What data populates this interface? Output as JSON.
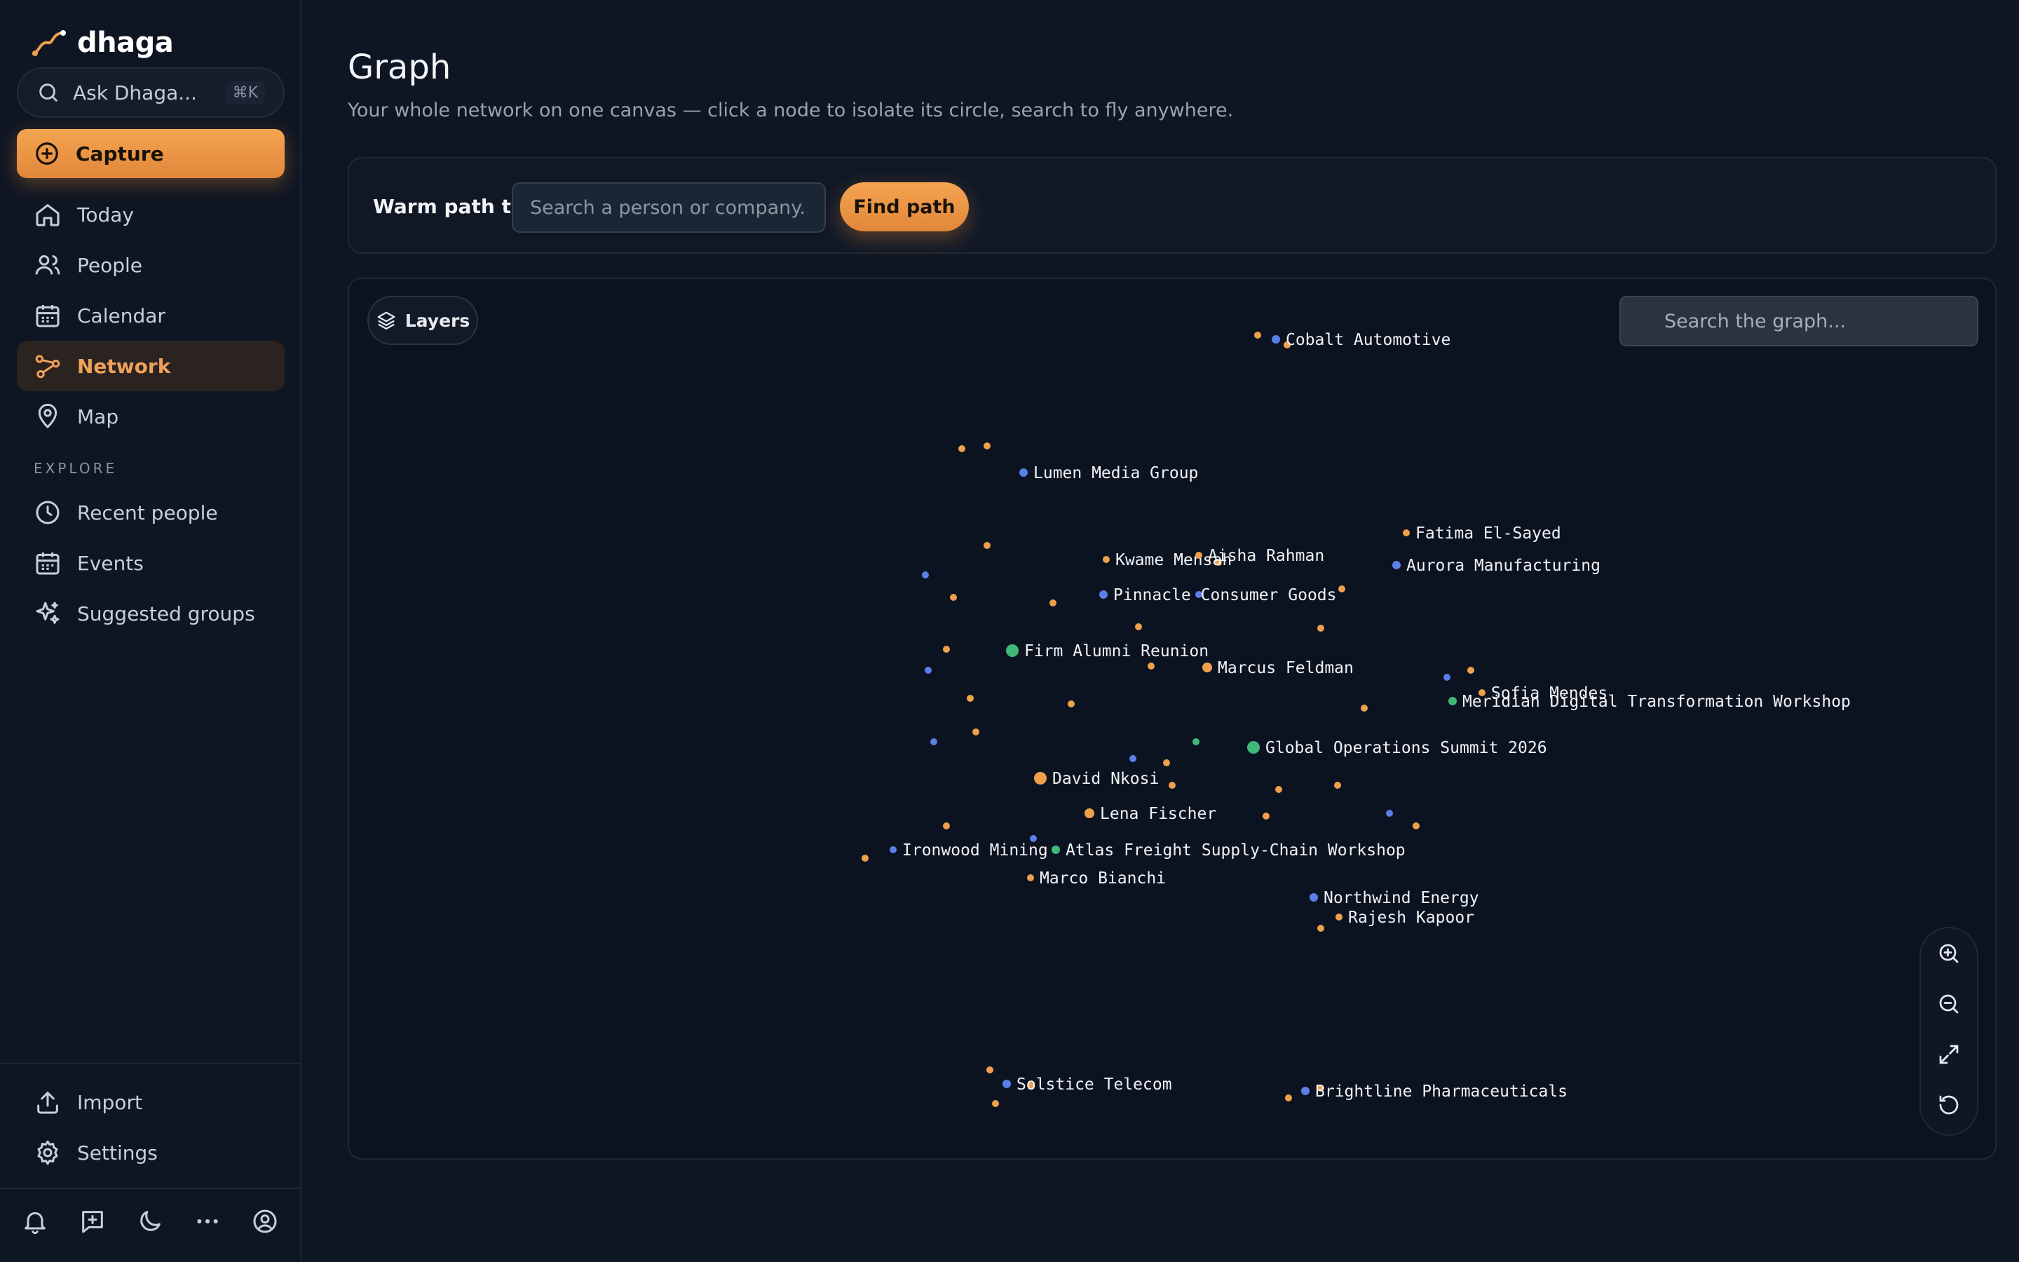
{
  "app": {
    "name": "dhaga"
  },
  "sidebar": {
    "ask": {
      "label": "Ask Dhaga...",
      "shortcut": "⌘K"
    },
    "capture_label": "Capture",
    "nav": [
      {
        "label": "Today",
        "icon": "home-icon"
      },
      {
        "label": "People",
        "icon": "people-icon"
      },
      {
        "label": "Calendar",
        "icon": "calendar-icon"
      },
      {
        "label": "Network",
        "icon": "network-icon",
        "active": true
      },
      {
        "label": "Map",
        "icon": "map-pin-icon"
      }
    ],
    "explore_label": "EXPLORE",
    "explore": [
      {
        "label": "Recent people",
        "icon": "clock-icon"
      },
      {
        "label": "Events",
        "icon": "calendar-icon"
      },
      {
        "label": "Suggested groups",
        "icon": "sparkles-icon"
      }
    ],
    "bottom_nav": [
      {
        "label": "Import",
        "icon": "upload-icon"
      },
      {
        "label": "Settings",
        "icon": "gear-icon"
      }
    ],
    "footer_icons": [
      "bell-icon",
      "add-note-icon",
      "moon-icon",
      "more-icon",
      "account-icon"
    ]
  },
  "main": {
    "title": "Graph",
    "subtitle": "Your whole network on one canvas — click a node to isolate its circle, search to fly anywhere.",
    "warm_path": {
      "label": "Warm path to",
      "placeholder": "Search a person or company...",
      "button": "Find path"
    },
    "graph": {
      "layers_label": "Layers",
      "search_placeholder": "Search the graph...",
      "zoom_controls": [
        "zoom-in-icon",
        "zoom-out-icon",
        "fit-view-icon",
        "reset-icon"
      ],
      "colors": {
        "person": "#f0a04b",
        "company": "#5b7fe8",
        "event": "#3fb87a"
      },
      "labeled_nodes": [
        {
          "label": "Cobalt Automotive",
          "type": "company"
        },
        {
          "label": "Lumen Media Group",
          "type": "company"
        },
        {
          "label": "Fatima El-Sayed",
          "type": "person"
        },
        {
          "label": "Kwame Mensah",
          "type": "person"
        },
        {
          "label": "Aisha Rahman",
          "type": "person"
        },
        {
          "label": "Aurora Manufacturing",
          "type": "company"
        },
        {
          "label": "Pinnacle Consumer Goods",
          "type": "company"
        },
        {
          "label": "Firm Alumni Reunion",
          "type": "event"
        },
        {
          "label": "Marcus Feldman",
          "type": "person"
        },
        {
          "label": "Sofia Mendes",
          "type": "person"
        },
        {
          "label": "Meridian Digital Transformation Workshop",
          "type": "event"
        },
        {
          "label": "Global Operations Summit 2026",
          "type": "event"
        },
        {
          "label": "David Nkosi",
          "type": "person"
        },
        {
          "label": "Lena Fischer",
          "type": "person"
        },
        {
          "label": "Ironwood Mining",
          "type": "company"
        },
        {
          "label": "Atlas Freight Supply-Chain Workshop",
          "type": "event"
        },
        {
          "label": "Marco Bianchi",
          "type": "person"
        },
        {
          "label": "Northwind Energy",
          "type": "company"
        },
        {
          "label": "Rajesh Kapoor",
          "type": "person"
        },
        {
          "label": "Solstice Telecom",
          "type": "company"
        },
        {
          "label": "Brightline Pharmaceuticals",
          "type": "company"
        }
      ]
    }
  }
}
